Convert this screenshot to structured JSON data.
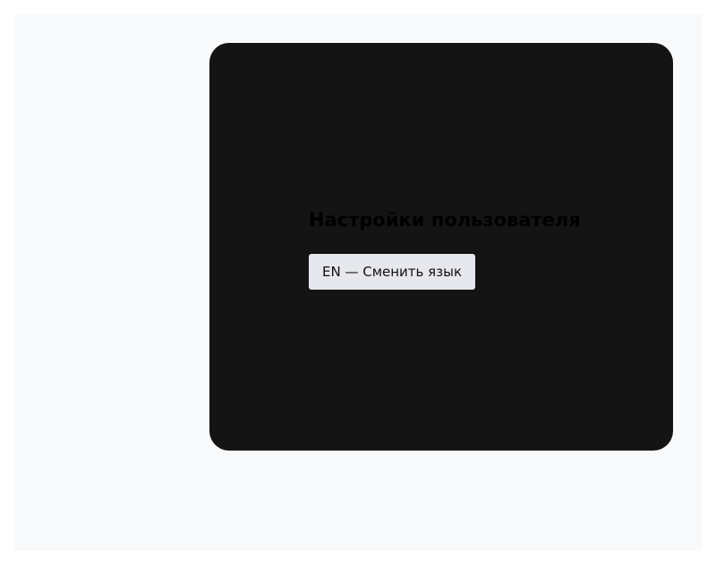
{
  "settings": {
    "title": "Настройки пользователя",
    "language_button_label": "EN — Сменить язык"
  },
  "colors": {
    "page_background": "#f8f9fb",
    "panel_background": "#141414",
    "button_background": "#e7e8ed",
    "title_text": "#000000"
  }
}
